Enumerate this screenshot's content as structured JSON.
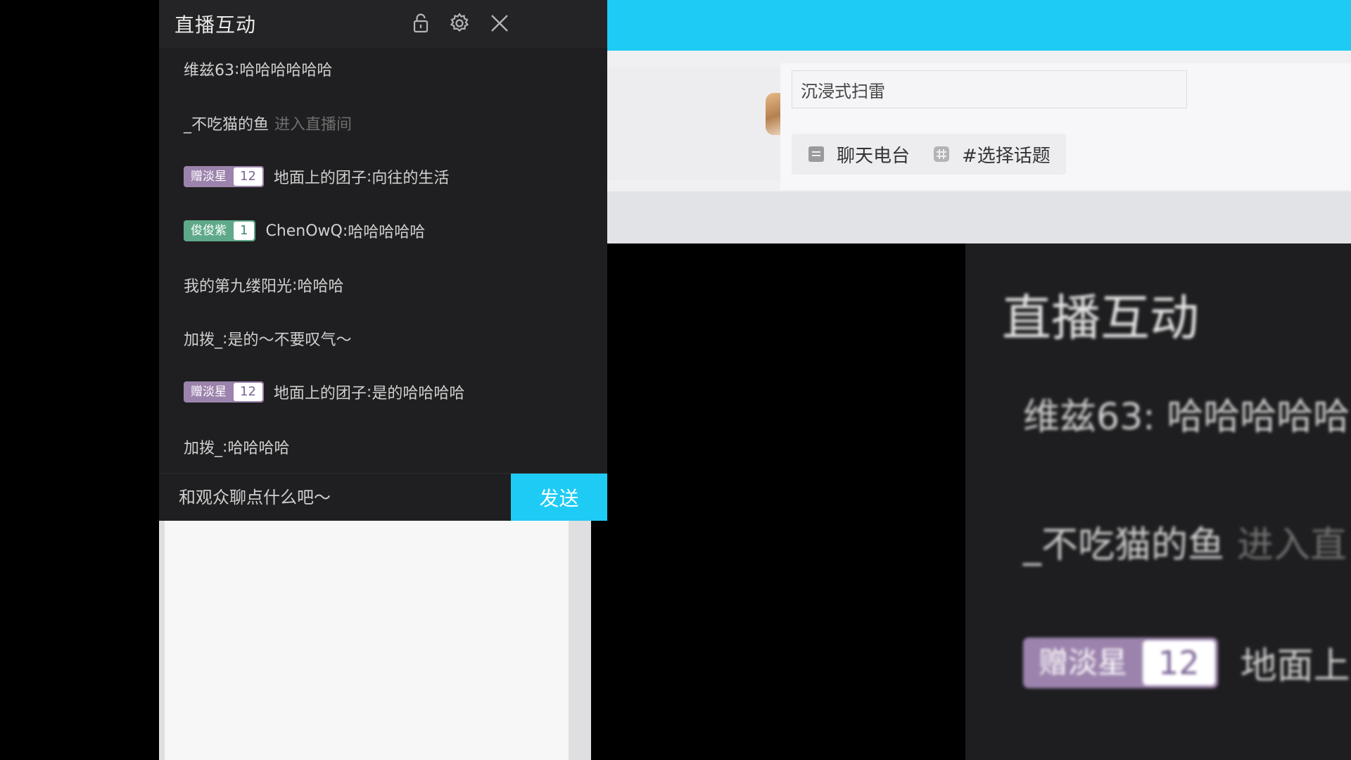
{
  "chat": {
    "title": "直播互动",
    "icons": {
      "lock": "lock-icon",
      "settings": "gear-icon",
      "close": "close-icon"
    },
    "messages": [
      {
        "user": "维兹63",
        "text": "哈哈哈哈哈哈"
      },
      {
        "user": "_不吃猫的鱼",
        "system_text": "进入直播间"
      },
      {
        "badge": {
          "name": "赠淡星",
          "level": "12"
        },
        "user": "地面上的团子",
        "text": "向往的生活"
      },
      {
        "badge": {
          "name": "俊俊紫",
          "level": "1"
        },
        "user": "ChenOwQ",
        "text": "哈哈哈哈哈"
      },
      {
        "user": "我的第九缕阳光",
        "text": "哈哈哈"
      },
      {
        "user": "加拨_",
        "text": "是的～不要叹气～"
      },
      {
        "badge": {
          "name": "赠淡星",
          "level": "12"
        },
        "user": "地面上的团子",
        "text": "是的哈哈哈哈"
      },
      {
        "user": "加拨_",
        "text": "哈哈哈哈"
      }
    ],
    "input_placeholder": "和观众聊点什么吧～",
    "send_label": "发送"
  },
  "stream_form": {
    "title_value": "沉浸式扫雷",
    "category_label": "聊天电台",
    "topic_label": "#选择话题"
  },
  "blurred_preview": {
    "title": "直播互动",
    "msg1": "维兹63: 哈哈哈哈哈",
    "msg2_user": "_不吃猫的鱼",
    "msg2_sys": "进入直",
    "badge_name": "赠淡星",
    "badge_level": "12",
    "msg3_text": "地面上"
  },
  "colors": {
    "accent": "#1ecbf5",
    "badge_purple": "#9c83ad",
    "badge_purple_text": "#7b6396",
    "badge_green": "#5fa98a",
    "badge_green_text": "#3f8a6b",
    "panel_bg": "#1f1f21"
  }
}
